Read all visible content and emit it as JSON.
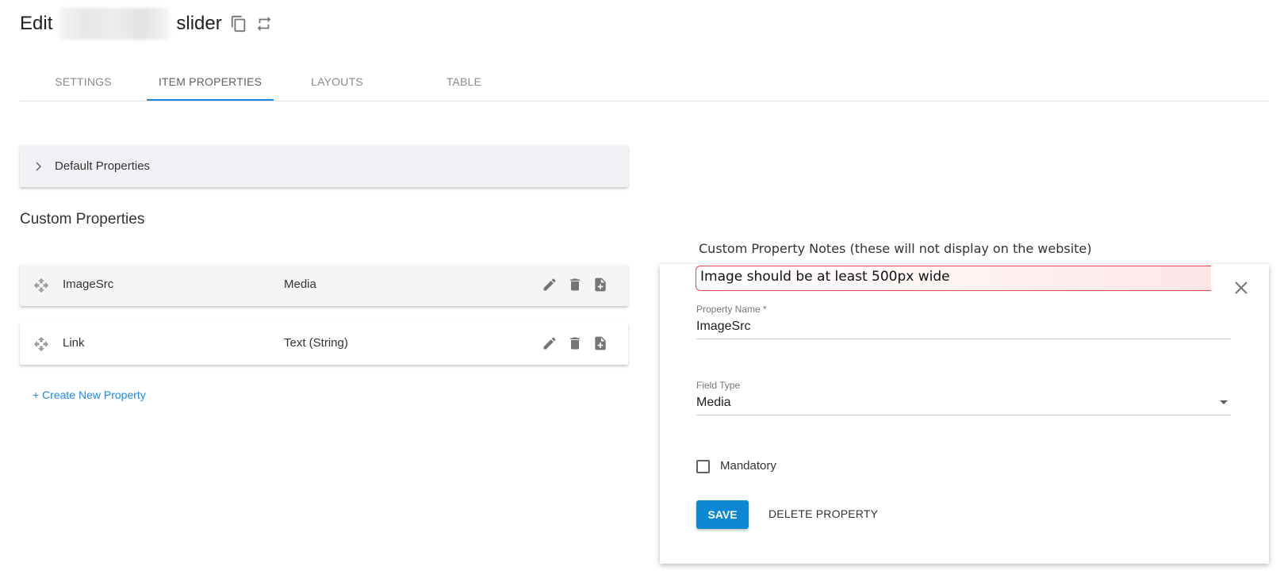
{
  "header": {
    "title_prefix": "Edit",
    "title_suffix": "slider",
    "icons": [
      "copy-icon",
      "repeat-icon"
    ]
  },
  "tabs": [
    {
      "label": "SETTINGS"
    },
    {
      "label": "ITEM PROPERTIES"
    },
    {
      "label": "LAYOUTS"
    },
    {
      "label": "TABLE"
    }
  ],
  "active_tab": "ITEM PROPERTIES",
  "default_panel": {
    "label": "Default Properties"
  },
  "custom_section": {
    "title": "Custom Properties"
  },
  "properties": [
    {
      "name": "ImageSrc",
      "type": "Media"
    },
    {
      "name": "Link",
      "type": "Text (String)"
    }
  ],
  "create_link": "+ Create New Property",
  "notes": {
    "label": "Custom Property Notes (these will not display on the website)",
    "text": "Image should be at least 500px wide"
  },
  "form": {
    "property_name_label": "Property Name *",
    "property_name_value": "ImageSrc",
    "field_type_label": "Field Type",
    "field_type_value": "Media",
    "mandatory_label": "Mandatory",
    "save_label": "SAVE",
    "delete_label": "DELETE PROPERTY"
  },
  "colors": {
    "accent": "#1e88e5",
    "save_button": "#0b87d4",
    "note_border": "#e0444e"
  }
}
